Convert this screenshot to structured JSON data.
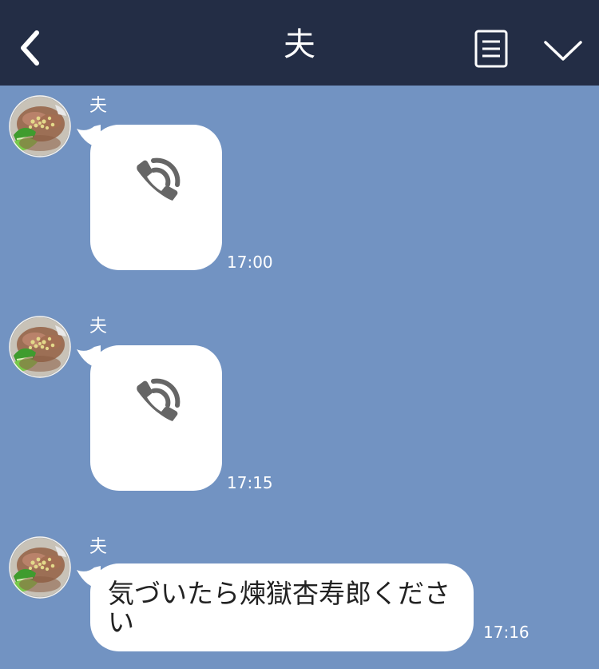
{
  "header": {
    "title": "夫"
  },
  "messages": [
    {
      "sender": "夫",
      "type": "call",
      "time": "17:00"
    },
    {
      "sender": "夫",
      "type": "call",
      "time": "17:15"
    },
    {
      "sender": "夫",
      "type": "text",
      "text": "気づいたら煉獄杏寿郎ください",
      "time": "17:16"
    }
  ],
  "icons": {
    "back": "chevron-left-icon",
    "menu": "document-menu-icon",
    "expand": "chevron-down-icon",
    "call": "phone-call-icon"
  },
  "colors": {
    "header_bg": "#232d45",
    "chat_bg": "#7293c2",
    "bubble": "#ffffff",
    "call_icon": "#666666"
  }
}
